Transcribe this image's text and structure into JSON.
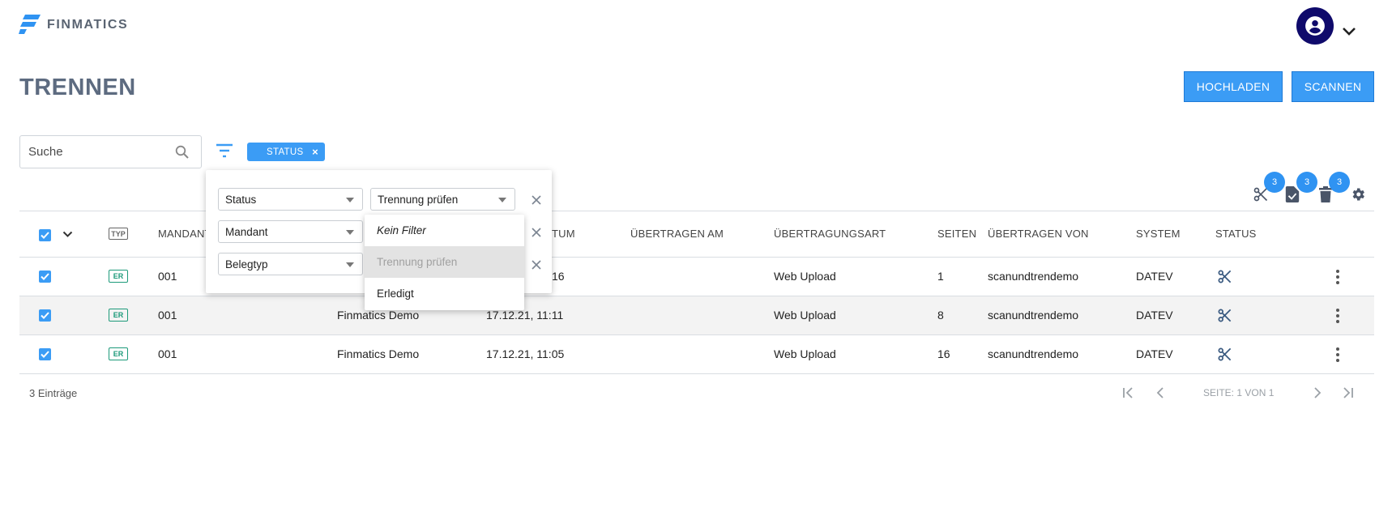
{
  "app": {
    "brand": "FINMATICS"
  },
  "page": {
    "title": "TRENNEN"
  },
  "actions": {
    "upload": "HOCHLADEN",
    "scan": "SCANNEN"
  },
  "search": {
    "placeholder": "Suche"
  },
  "active_filter_chip": {
    "label": "STATUS",
    "close": "×"
  },
  "toolbar": {
    "split_count": "3",
    "approve_count": "3",
    "delete_count": "3"
  },
  "filter_panel": {
    "rows": [
      {
        "field": "Status",
        "value": "Trennung prüfen"
      },
      {
        "field": "Mandant",
        "value": ""
      },
      {
        "field": "Belegtyp",
        "value": ""
      }
    ],
    "dropdown_options": [
      "Kein Filter",
      "Trennung prüfen",
      "Erledigt"
    ]
  },
  "table": {
    "columns": {
      "typ": "TYP",
      "mandant": "MANDANT",
      "datum_suffix": "TUM",
      "uebertragen_am": "ÜBERTRAGEN AM",
      "uebertragungsart": "ÜBERTRAGUNGSART",
      "seiten": "SEITEN",
      "uebertragen_von": "ÜBERTRAGEN VON",
      "system": "SYSTEM",
      "status": "STATUS"
    },
    "rows": [
      {
        "typ": "ER",
        "mandant": "001",
        "name": "",
        "datum": "16",
        "uebertragungsart": "Web Upload",
        "seiten": "1",
        "uebertragen_von": "scanundtrendemo",
        "system": "DATEV"
      },
      {
        "typ": "ER",
        "mandant": "001",
        "name": "Finmatics Demo",
        "datum": "17.12.21, 11:11",
        "uebertragungsart": "Web Upload",
        "seiten": "8",
        "uebertragen_von": "scanundtrendemo",
        "system": "DATEV"
      },
      {
        "typ": "ER",
        "mandant": "001",
        "name": "Finmatics Demo",
        "datum": "17.12.21, 11:05",
        "uebertragungsart": "Web Upload",
        "seiten": "16",
        "uebertragen_von": "scanundtrendemo",
        "system": "DATEV"
      }
    ]
  },
  "footer": {
    "count": "3 Einträge",
    "page": "SEITE: 1 VON 1"
  }
}
